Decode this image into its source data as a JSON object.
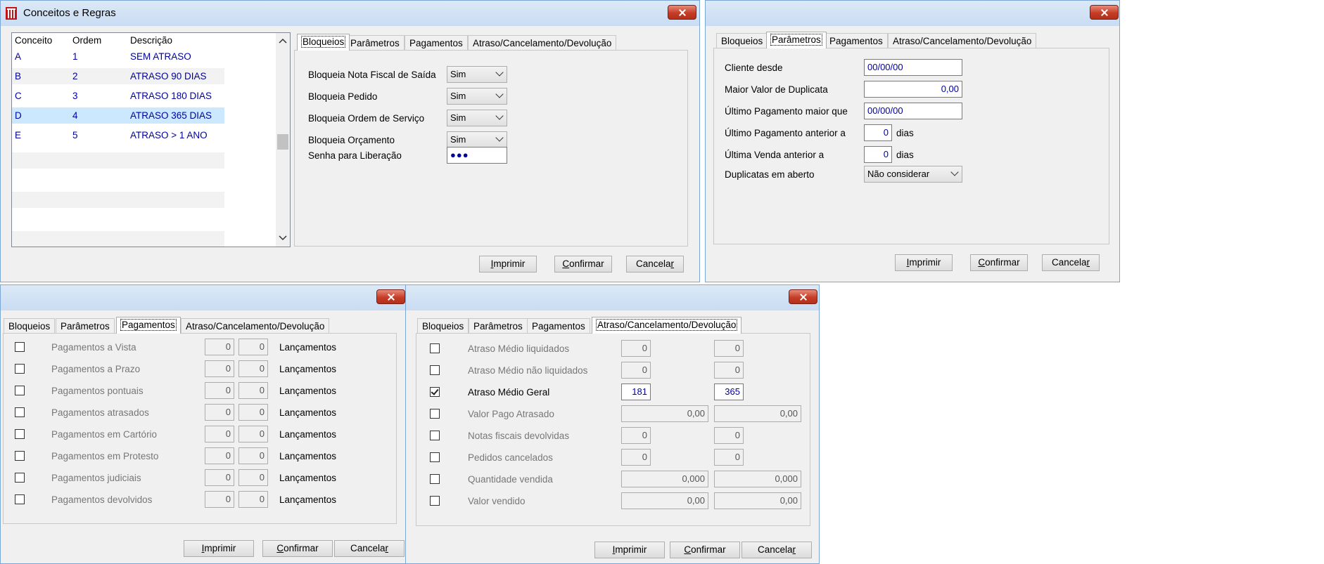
{
  "window_main": {
    "title": "Conceitos e Regras",
    "grid": {
      "headers": [
        "Conceito",
        "Ordem",
        "Descrição"
      ],
      "rows": [
        {
          "conceito": "A",
          "ordem": "1",
          "descricao": "SEM ATRASO"
        },
        {
          "conceito": "B",
          "ordem": "2",
          "descricao": "ATRASO 90 DIAS"
        },
        {
          "conceito": "C",
          "ordem": "3",
          "descricao": "ATRASO 180 DIAS"
        },
        {
          "conceito": "D",
          "ordem": "4",
          "descricao": "ATRASO 365 DIAS"
        },
        {
          "conceito": "E",
          "ordem": "5",
          "descricao": "ATRASO > 1 ANO"
        }
      ],
      "selected_index": 3
    },
    "bloqueios": {
      "fields": [
        {
          "label": "Bloqueia Nota Fiscal de Saída",
          "value": "Sim"
        },
        {
          "label": "Bloqueia Pedido",
          "value": "Sim"
        },
        {
          "label": "Bloqueia Ordem de Serviço",
          "value": "Sim"
        },
        {
          "label": "Bloqueia Orçamento",
          "value": "Sim"
        }
      ],
      "password_label": "Senha para Liberação",
      "password_value": "●●●"
    }
  },
  "tabs": [
    "Bloqueios",
    "Parâmetros",
    "Pagamentos",
    "Atraso/Cancelamento/Devolução"
  ],
  "buttons": {
    "print": "Imprimir",
    "confirm": "Confirmar",
    "cancel": "Cancelar"
  },
  "parametros": {
    "fields": [
      {
        "label": "Cliente desde",
        "value": "00/00/00"
      },
      {
        "label": "Maior Valor de Duplicata",
        "value": "0,00"
      },
      {
        "label": "Último Pagamento maior que",
        "value": "00/00/00"
      },
      {
        "label": "Último Pagamento anterior a",
        "value": "0",
        "suffix": "dias"
      },
      {
        "label": "Última Venda anterior a",
        "value": "0",
        "suffix": "dias"
      }
    ],
    "duplicatas_label": "Duplicatas em aberto",
    "duplicatas_value": "Não considerar"
  },
  "pagamentos": {
    "suffix": "Lançamentos",
    "rows": [
      {
        "label": "Pagamentos a Vista",
        "v1": "0",
        "v2": "0"
      },
      {
        "label": "Pagamentos a Prazo",
        "v1": "0",
        "v2": "0"
      },
      {
        "label": "Pagamentos pontuais",
        "v1": "0",
        "v2": "0"
      },
      {
        "label": "Pagamentos atrasados",
        "v1": "0",
        "v2": "0"
      },
      {
        "label": "Pagamentos em Cartório",
        "v1": "0",
        "v2": "0"
      },
      {
        "label": "Pagamentos em Protesto",
        "v1": "0",
        "v2": "0"
      },
      {
        "label": "Pagamentos judiciais",
        "v1": "0",
        "v2": "0"
      },
      {
        "label": "Pagamentos devolvidos",
        "v1": "0",
        "v2": "0"
      }
    ]
  },
  "atraso": {
    "rows": [
      {
        "label": "Atraso Médio liquidados",
        "v1": "0",
        "v2": "0",
        "checked": false,
        "wide": false
      },
      {
        "label": "Atraso Médio não liquidados",
        "v1": "0",
        "v2": "0",
        "checked": false,
        "wide": false
      },
      {
        "label": "Atraso Médio Geral",
        "v1": "181",
        "v2": "365",
        "checked": true,
        "wide": false
      },
      {
        "label": "Valor Pago Atrasado",
        "v1": "0,00",
        "v2": "0,00",
        "checked": false,
        "wide": true
      },
      {
        "label": "Notas fiscais devolvidas",
        "v1": "0",
        "v2": "0",
        "checked": false,
        "wide": false
      },
      {
        "label": "Pedidos cancelados",
        "v1": "0",
        "v2": "0",
        "checked": false,
        "wide": false
      },
      {
        "label": "Quantidade vendida",
        "v1": "0,000",
        "v2": "0,000",
        "checked": false,
        "wide": true
      },
      {
        "label": "Valor vendido",
        "v1": "0,00",
        "v2": "0,00",
        "checked": false,
        "wide": true
      }
    ]
  }
}
